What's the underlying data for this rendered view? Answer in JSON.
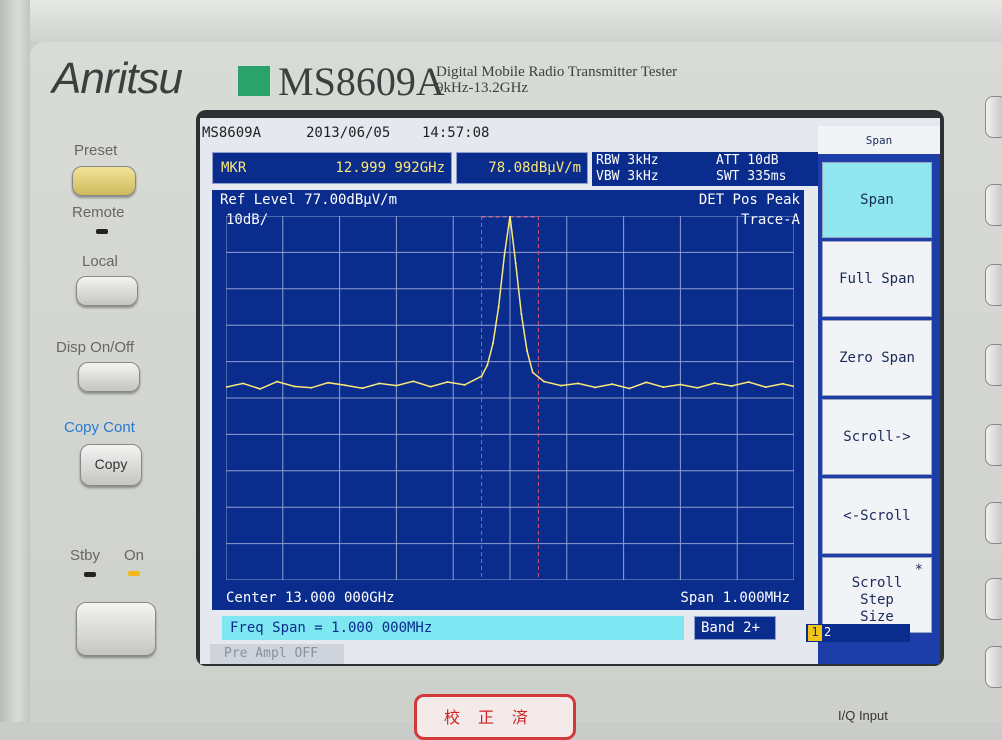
{
  "instrument": {
    "brand": "Anritsu",
    "model": "MS8609A",
    "description_line1": "Digital Mobile Radio Transmitter Tester",
    "description_line2": "9kHz-13.2GHz",
    "brand_color": "#2aa36b"
  },
  "front_panel": {
    "preset": "Preset",
    "remote": "Remote",
    "local": "Local",
    "disp": "Disp  On/Off",
    "copy_cont": "Copy  Cont",
    "copy": "Copy",
    "stby": "Stby",
    "on": "On",
    "calibration_stamp": "校正済",
    "iq_input": "I/Q Input"
  },
  "screen": {
    "model": "MS8609A",
    "date": "2013/06/05",
    "time": "14:57:08",
    "marker_label": "MKR",
    "marker_freq": "12.999 992GHz",
    "marker_level": "78.08dBµV/m",
    "rbw": "RBW 3kHz",
    "vbw": "VBW 3kHz",
    "att": "ATT 10dB",
    "swt": "SWT 335ms",
    "ref_level": "Ref Level  77.00dBµV/m",
    "scale": "10dB/",
    "detector": "DET  Pos Peak",
    "trace": "Trace-A",
    "center": "Center 13.000 000GHz",
    "span": "Span 1.000MHz",
    "freq_span_field": "Freq Span = 1.000 000MHz",
    "band": "Band 2+",
    "preamp": "Pre Ampl OFF",
    "page_indicator": [
      "1",
      "2"
    ]
  },
  "softkeys": {
    "title": "Span",
    "keys": [
      "Span",
      "Full Span",
      "Zero Span",
      "Scroll->",
      "<-Scroll",
      "Scroll Step Size"
    ],
    "star_marker": "*"
  },
  "chart_data": {
    "type": "line",
    "title": "",
    "xlabel": "",
    "ylabel": "",
    "x_unit": "MHz",
    "x_range": [
      12.9995,
      13.0005
    ],
    "ylim": [
      -23,
      77
    ],
    "y_unit": "dBµV/m",
    "grid": true,
    "series": [
      {
        "values": [
          {
            "x": 12.9995,
            "y": 30.0
          },
          {
            "x": 12.99953,
            "y": 31.0
          },
          {
            "x": 12.99956,
            "y": 29.5
          },
          {
            "x": 12.99959,
            "y": 31.5
          },
          {
            "x": 12.99962,
            "y": 30.2
          },
          {
            "x": 12.99965,
            "y": 29.8
          },
          {
            "x": 12.99968,
            "y": 31.2
          },
          {
            "x": 12.99971,
            "y": 30.5
          },
          {
            "x": 12.99974,
            "y": 29.7
          },
          {
            "x": 12.99977,
            "y": 31.0
          },
          {
            "x": 12.9998,
            "y": 30.4
          },
          {
            "x": 12.99983,
            "y": 31.6
          },
          {
            "x": 12.99986,
            "y": 30.1
          },
          {
            "x": 12.99989,
            "y": 31.4
          },
          {
            "x": 12.99992,
            "y": 30.6
          },
          {
            "x": 12.99995,
            "y": 33.0
          },
          {
            "x": 12.99996,
            "y": 36.0
          },
          {
            "x": 12.99997,
            "y": 42.0
          },
          {
            "x": 12.99998,
            "y": 52.0
          },
          {
            "x": 12.99999,
            "y": 66.0
          },
          {
            "x": 13.0,
            "y": 77.0
          },
          {
            "x": 13.00001,
            "y": 64.0
          },
          {
            "x": 13.00002,
            "y": 50.0
          },
          {
            "x": 13.00003,
            "y": 40.0
          },
          {
            "x": 13.00004,
            "y": 34.0
          },
          {
            "x": 13.00006,
            "y": 31.5
          },
          {
            "x": 13.00009,
            "y": 30.4
          },
          {
            "x": 13.00012,
            "y": 31.0
          },
          {
            "x": 13.00015,
            "y": 29.9
          },
          {
            "x": 13.00018,
            "y": 30.8
          },
          {
            "x": 13.00021,
            "y": 29.6
          },
          {
            "x": 13.00024,
            "y": 31.3
          },
          {
            "x": 13.00027,
            "y": 30.0
          },
          {
            "x": 13.0003,
            "y": 30.7
          },
          {
            "x": 13.00033,
            "y": 29.8
          },
          {
            "x": 13.00036,
            "y": 31.1
          },
          {
            "x": 13.00039,
            "y": 30.3
          },
          {
            "x": 13.00042,
            "y": 31.4
          },
          {
            "x": 13.00045,
            "y": 30.0
          },
          {
            "x": 13.00048,
            "y": 30.9
          },
          {
            "x": 13.0005,
            "y": 30.2
          }
        ]
      }
    ],
    "marker": {
      "x": 12.999992,
      "y": 78.08
    },
    "zone_window": [
      12.99995,
      13.00005
    ],
    "colors": {
      "trace": "#fbe77a",
      "grid": "#8fa0d0",
      "zone": "#e05070",
      "background": "#0a2c8c"
    }
  }
}
